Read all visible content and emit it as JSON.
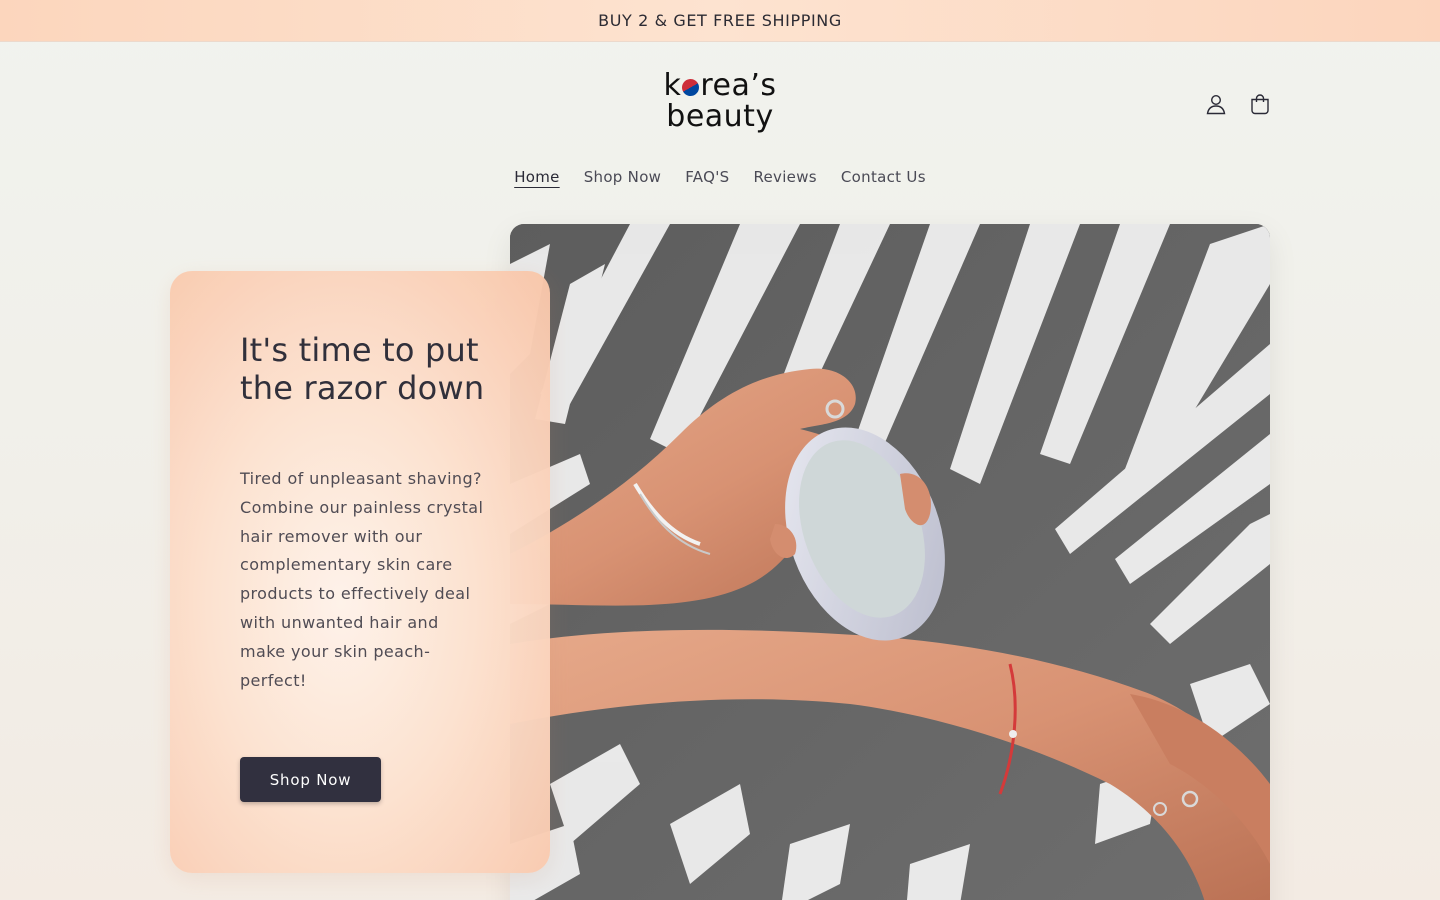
{
  "announcement": {
    "text": "BUY 2 & GET FREE SHIPPING"
  },
  "header": {
    "logo_line1_a": "k",
    "logo_line1_b": "rea’s",
    "logo_line2": "beauty",
    "account_icon": "user-icon",
    "cart_icon": "bag-icon"
  },
  "nav": {
    "items": [
      {
        "label": "Home",
        "active": true
      },
      {
        "label": "Shop Now",
        "active": false
      },
      {
        "label": "FAQ'S",
        "active": false
      },
      {
        "label": "Reviews",
        "active": false
      },
      {
        "label": "Contact Us",
        "active": false
      }
    ]
  },
  "hero": {
    "heading": "It's time to put the razor down",
    "body": "Tired of unpleasant shaving? Combine our painless crystal hair remover with our complementary skin care products to effectively deal with unwanted hair and make your skin peach-perfect!",
    "button_label": "Shop Now",
    "image_subject": "hand holding crystal hair remover over forearm with palm leaf shadows"
  },
  "colors": {
    "announcement_bg": "#fcd6bd",
    "button_bg": "#2b2a3a",
    "card_peach": "#f9c6a9",
    "text_dark": "#2b2a36"
  }
}
